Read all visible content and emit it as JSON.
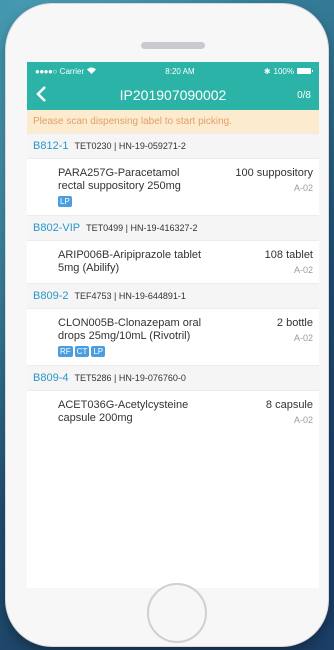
{
  "status_bar": {
    "carrier": "Carrier",
    "time": "8:20 AM",
    "battery": "100%"
  },
  "nav": {
    "back_icon": "chevron-left-icon",
    "title": "IP201907090002",
    "count": "0/8"
  },
  "banner": "Please scan dispensing label to start picking.",
  "colors": {
    "accent": "#2ab3a6",
    "banner_bg": "#fcebcf",
    "banner_text": "#e0a06a",
    "code": "#2a97c8",
    "tag": "#4a9de0"
  },
  "orders": [
    {
      "code": "B812-1",
      "info": "TET0230 | HN-19-059271-2",
      "drug": "PARA257G-Paracetamol rectal suppository 250mg",
      "qty": "100 suppository",
      "loc": "A-02",
      "tags": [
        "LP"
      ]
    },
    {
      "code": "B802-VIP",
      "info": "TET0499 | HN-19-416327-2",
      "drug": "ARIP006B-Aripiprazole tablet 5mg (Abilify)",
      "qty": "108 tablet",
      "loc": "A-02",
      "tags": []
    },
    {
      "code": "B809-2",
      "info": "TEF4753 | HN-19-644891-1",
      "drug": "CLON005B-Clonazepam oral drops 25mg/10mL (Rivotril)",
      "qty": "2 bottle",
      "loc": "A-02",
      "tags": [
        "RF",
        "CT",
        "LP"
      ]
    },
    {
      "code": "B809-4",
      "info": "TET5286 | HN-19-076760-0",
      "drug": "ACET036G-Acetylcysteine capsule 200mg",
      "qty": "8 capsule",
      "loc": "A-02",
      "tags": []
    }
  ]
}
